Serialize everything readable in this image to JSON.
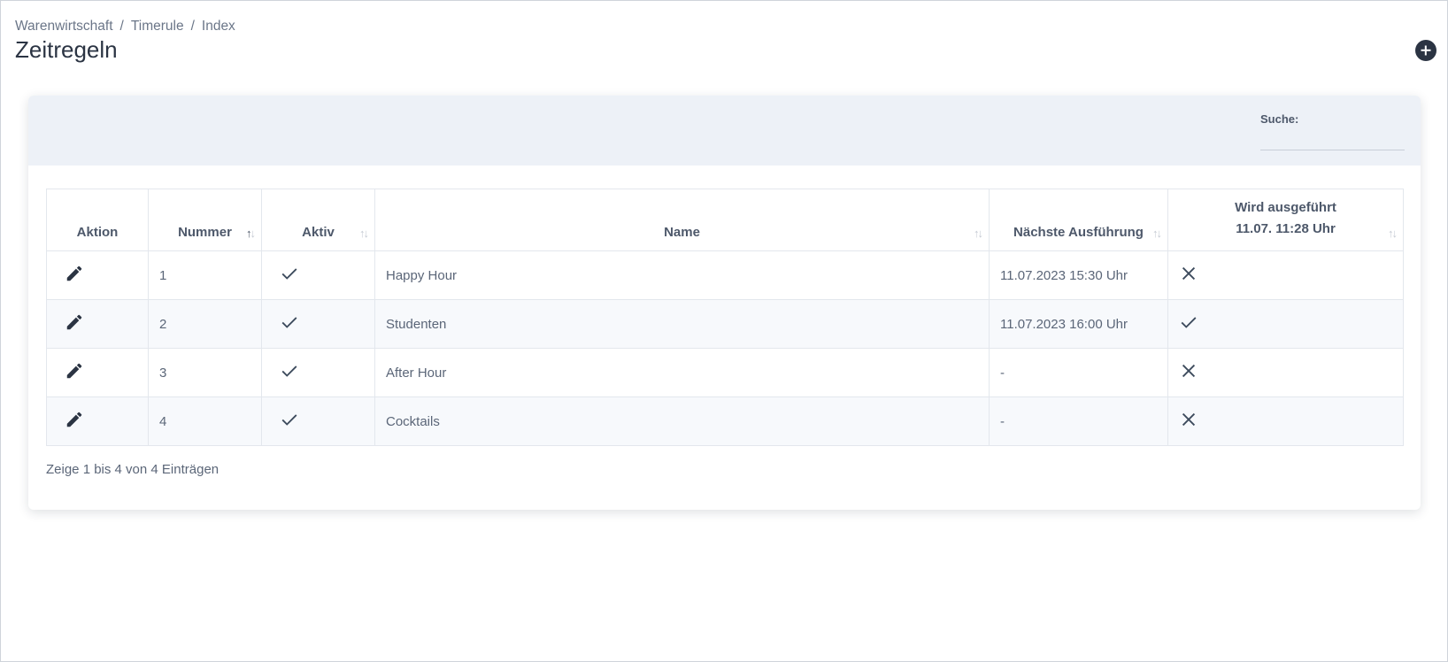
{
  "breadcrumb": [
    "Warenwirtschaft",
    "Timerule",
    "Index"
  ],
  "breadcrumb_separator": "/",
  "page_title": "Zeitregeln",
  "search": {
    "label": "Suche:",
    "value": ""
  },
  "table": {
    "headers": {
      "aktion": "Aktion",
      "nummer": "Nummer",
      "aktiv": "Aktiv",
      "name": "Name",
      "naechste": "Nächste Ausführung",
      "wird_line1": "Wird ausgeführt",
      "wird_line2": "11.07. 11:28 Uhr"
    },
    "sorted_column": "nummer",
    "sort_direction": "ascending",
    "rows": [
      {
        "nummer": "1",
        "aktiv": "check",
        "name": "Happy Hour",
        "naechste": "11.07.2023 15:30 Uhr",
        "wird": "cross"
      },
      {
        "nummer": "2",
        "aktiv": "check",
        "name": "Studenten",
        "naechste": "11.07.2023 16:00 Uhr",
        "wird": "check"
      },
      {
        "nummer": "3",
        "aktiv": "check",
        "name": "After Hour",
        "naechste": "-",
        "wird": "cross"
      },
      {
        "nummer": "4",
        "aktiv": "check",
        "name": "Cocktails",
        "naechste": "-",
        "wird": "cross"
      }
    ]
  },
  "info_text": "Zeige 1 bis 4 von 4 Einträgen",
  "icons": {
    "edit": "pencil-icon",
    "active": "check-icon",
    "inactive": "close-icon",
    "add": "plus-circle-icon"
  },
  "colors": {
    "title": "#2b3443",
    "card_header": "#edf1f7",
    "icon": "#3c4a5c"
  }
}
